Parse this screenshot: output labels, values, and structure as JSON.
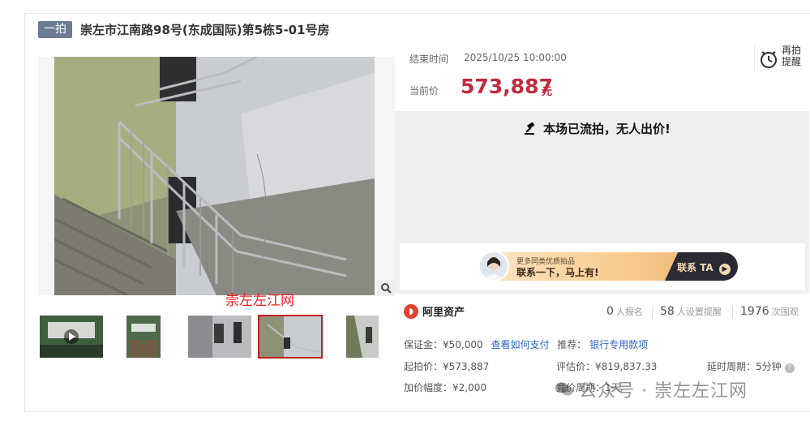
{
  "header": {
    "tag": "一拍",
    "title": "崇左市江南路98号(东成国际)第5栋5-01号房"
  },
  "gallery": {
    "watermark": "崇左左江网",
    "thumb_count": 5,
    "selected_index": 3
  },
  "auction": {
    "end_label": "结束时间",
    "end_value": "2025/10/25 10:00:00",
    "remind_label": "再拍提醒",
    "price_label": "当前价",
    "price_value": "573,887",
    "price_unit": "元",
    "status_message": "本场已流拍，无人出价!"
  },
  "banner": {
    "sub": "更多同类优质拍品",
    "main": "联系一下，马上有!",
    "cta": "联系 TA"
  },
  "stats": {
    "brand": "阿里资产",
    "signups_value": "0",
    "signups_label": "人报名",
    "reminders_value": "58",
    "reminders_label": "人设置提醒",
    "views_value": "1976",
    "views_label": "次围观"
  },
  "details": {
    "deposit": "保证金：¥50,000",
    "pay_link": "查看如何支付",
    "recommend_label": "推荐：",
    "recommend_link": "银行专用款项",
    "start_price": "起拍价：¥573,887",
    "appraisal": "评估价：¥819,837.33",
    "delay": "延时周期：5分钟",
    "increment": "加价幅度：¥2,000",
    "bid_cycle": "竞价周期：1天"
  },
  "footer_watermark": "公众号 · 崇左左江网",
  "colors": {
    "accent_price": "#c0293e",
    "tag_bg": "#6b7a95",
    "link": "#2a66c8",
    "selected_thumb": "#c21f1f"
  }
}
